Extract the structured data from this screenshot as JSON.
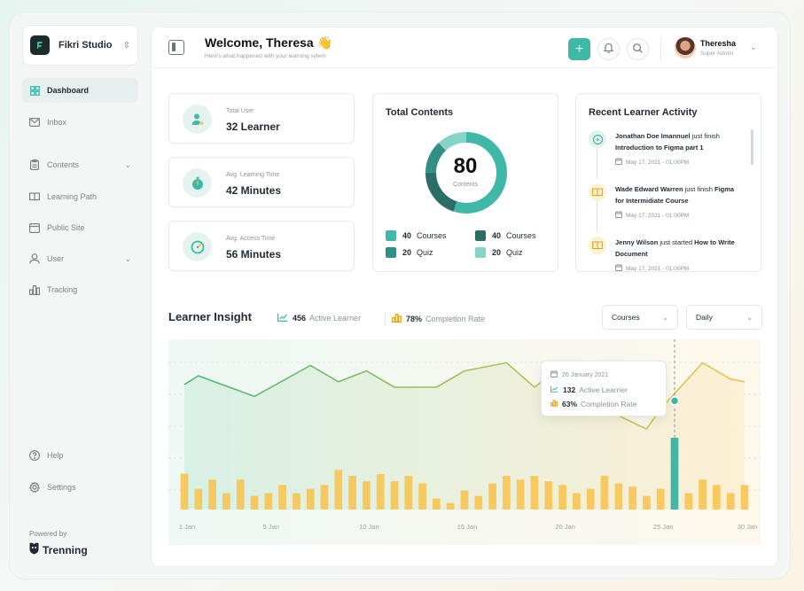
{
  "brand": {
    "name": "Fikri Studio"
  },
  "sidebar": {
    "items": [
      {
        "label": "Dashboard",
        "icon": "grid-icon",
        "active": true
      },
      {
        "label": "Inbox",
        "icon": "mail-icon"
      },
      {
        "label": "Contents",
        "icon": "clipboard-icon",
        "has_submenu": true
      },
      {
        "label": "Learning Path",
        "icon": "book-open-icon"
      },
      {
        "label": "Public Site",
        "icon": "browser-icon"
      },
      {
        "label": "User",
        "icon": "user-icon",
        "has_submenu": true
      },
      {
        "label": "Tracking",
        "icon": "bar-chart-icon"
      }
    ],
    "bottom": [
      {
        "label": "Help",
        "icon": "help-icon"
      },
      {
        "label": "Settings",
        "icon": "gear-icon"
      }
    ],
    "powered_by": "Powered by",
    "powered_brand": "Trenning"
  },
  "header": {
    "welcome": "Welcome, Theresa 👋",
    "subtitle": "Here's what happened with your learning sytem",
    "user_name": "Theresha",
    "user_role": "Super Admin"
  },
  "stats": [
    {
      "label": "Total User",
      "value": "32 Learner",
      "icon": "user-star-icon"
    },
    {
      "label": "Avg. Learning Time",
      "value": "42 Minutes",
      "icon": "stopwatch-icon"
    },
    {
      "label": "Avg. Access Time",
      "value": "56 Minutes",
      "icon": "gauge-icon"
    }
  ],
  "total_contents": {
    "title": "Total Contents",
    "value": "80",
    "label": "Contents",
    "segments": [
      {
        "count": "40",
        "name": "Courses",
        "color": "#3fb8a8",
        "fraction": 0.55
      },
      {
        "count": "40",
        "name": "Courses",
        "color": "#2a6e67",
        "fraction": 0.2
      },
      {
        "count": "20",
        "name": "Quiz",
        "color": "#318f85",
        "fraction": 0.13
      },
      {
        "count": "20",
        "name": "Quiz",
        "color": "#86d3c8",
        "fraction": 0.12
      }
    ]
  },
  "activity": {
    "title": "Recent Learner Activity",
    "items": [
      {
        "name": "Jonathan Doe Imannuel",
        "action": " just finish ",
        "target": "Introduction to Figma part 1",
        "date": "May 17, 2021 - 01:00PM",
        "icon": "video-icon",
        "color": "#e2f3ef"
      },
      {
        "name": "Wade Edward Warren",
        "action": " just finish ",
        "target": "Figma for Intermidiate Course",
        "date": "May 17, 2021 - 01:00PM",
        "icon": "book-icon",
        "color": "#fdf1d3"
      },
      {
        "name": "Jenny Wilson",
        "action": " just started ",
        "target": "How to Write Document",
        "date": "May 17, 2021 - 01:00PM",
        "icon": "book-icon",
        "color": "#fdf1d3"
      }
    ]
  },
  "insight": {
    "title": "Learner Insight",
    "active_value": "456",
    "active_label": "Active Learner",
    "completion_value": "78%",
    "completion_label": "Completion Rate",
    "filter_content": "Courses",
    "filter_period": "Daily",
    "tooltip": {
      "date": "26 January 2021",
      "active_value": "132",
      "active_label": "Active Learner",
      "completion_value": "63%",
      "completion_label": "Completion Rate"
    }
  },
  "chart_data": {
    "type": "bar",
    "x_tick_labels": [
      "1 Jan",
      "5 Jan",
      "10 Jan",
      "15 Jan",
      "20 Jan",
      "25 Jan",
      "30 Jan"
    ],
    "days": [
      1,
      2,
      3,
      4,
      5,
      6,
      7,
      8,
      9,
      10,
      11,
      12,
      13,
      14,
      15,
      16,
      17,
      18,
      19,
      20,
      21,
      22,
      23,
      24,
      25,
      26,
      27,
      28,
      29,
      30,
      31,
      32,
      33,
      34,
      35,
      36,
      37,
      38,
      39,
      40,
      41
    ],
    "series": [
      {
        "name": "Completion Rate",
        "type": "bar",
        "values": [
          66,
          38,
          55,
          30,
          55,
          25,
          30,
          45,
          30,
          38,
          45,
          73,
          62,
          52,
          65,
          52,
          62,
          48,
          20,
          12,
          35,
          25,
          48,
          62,
          55,
          62,
          52,
          45,
          30,
          38,
          62,
          48,
          42,
          25,
          38,
          132,
          30,
          55,
          45,
          30,
          45
        ]
      },
      {
        "name": "Active Learner",
        "type": "line",
        "x": [
          1,
          2,
          6,
          10,
          12,
          14,
          16,
          19,
          21,
          24,
          26,
          28,
          31,
          34,
          35,
          38,
          40,
          41
        ],
        "values": [
          230,
          246,
          208,
          265,
          235,
          255,
          225,
          225,
          255,
          270,
          225,
          265,
          185,
          148,
          185,
          270,
          240,
          235
        ]
      }
    ],
    "highlight_day": 36,
    "ylim": [
      0,
      300
    ],
    "colors": {
      "bar": "#f8c24a",
      "bar_highlight": "#3fb8a8",
      "line_left": "#4cb67a",
      "line_right": "#f2c14e"
    }
  }
}
